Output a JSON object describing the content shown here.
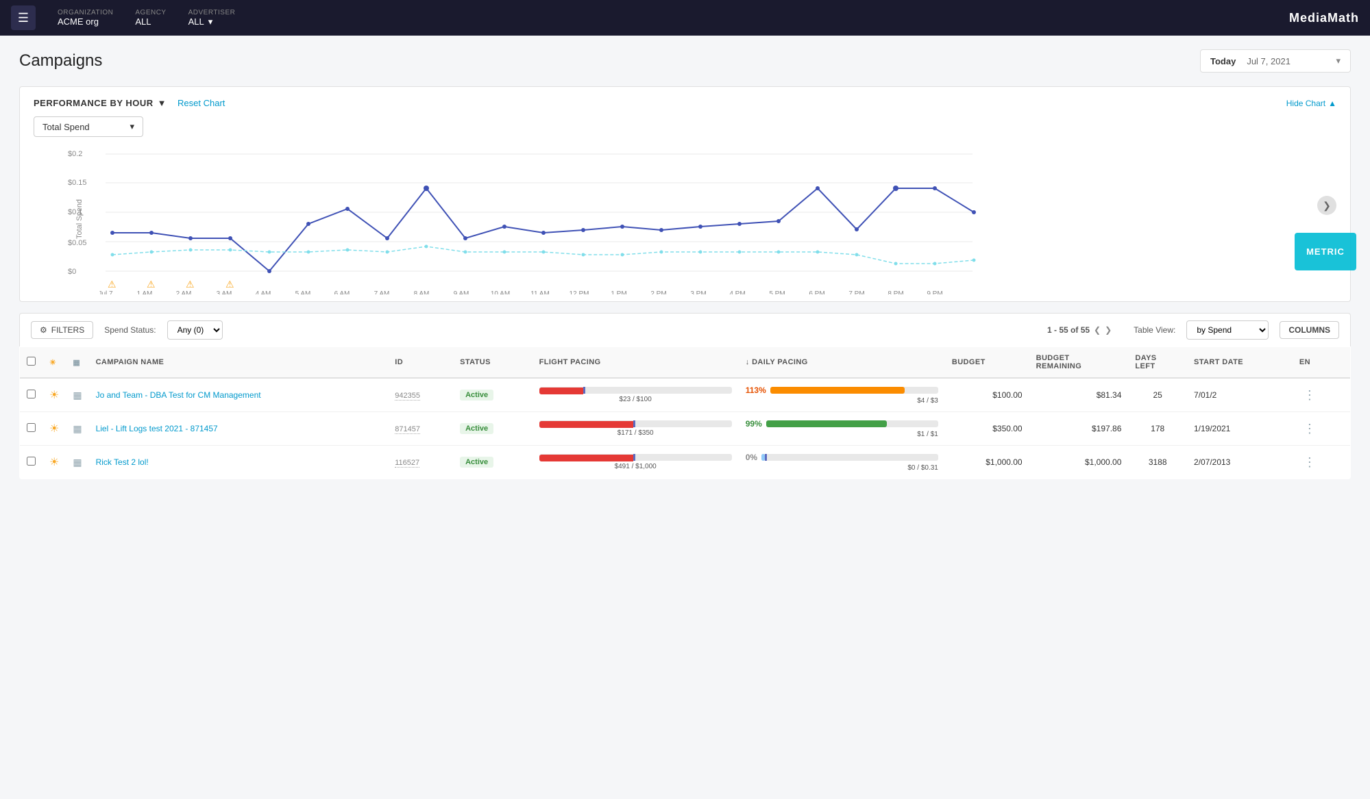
{
  "topnav": {
    "hamburger_label": "☰",
    "org_label": "ORGANIZATION",
    "org_value": "ACME org",
    "agency_label": "AGENCY",
    "agency_value": "ALL",
    "advertiser_label": "ADVERTISER",
    "advertiser_value": "ALL",
    "logo": "MediaMath"
  },
  "page": {
    "title": "Campaigns",
    "date_label": "Today",
    "date_value": "Jul 7, 2021",
    "hide_chart_label": "Hide Chart",
    "chart_section": {
      "perf_label": "PERFORMANCE BY  HOUR",
      "perf_arrow": "▼",
      "reset_chart_label": "Reset Chart",
      "metric_dropdown_label": "Total Spend",
      "y_axis_label": "Total Spend",
      "y_axis_values": [
        "$0.2",
        "$0.15",
        "$0.1",
        "$0.05",
        "$0"
      ],
      "x_axis_labels": [
        "Jul 7",
        "1 AM",
        "2 AM",
        "3 AM",
        "4 AM",
        "5 AM",
        "6 AM",
        "7 AM",
        "8 AM",
        "9 AM",
        "10 AM",
        "11 AM",
        "12 PM",
        "1 PM",
        "2 PM",
        "3 PM",
        "4 PM",
        "5 PM",
        "6 PM",
        "7 PM",
        "8 PM",
        "9 PM"
      ]
    }
  },
  "filters": {
    "filters_label": "FILTERS",
    "spend_status_label": "Spend Status:",
    "spend_status_value": "Any (0)",
    "pagination_text": "1 - 55 of 55",
    "table_view_label": "Table View:",
    "table_view_value": "by Spend",
    "columns_label": "COLUMNS"
  },
  "table": {
    "headers": [
      "",
      "",
      "",
      "CAMPAIGN NAME",
      "ID",
      "STATUS",
      "FLIGHT PACING",
      "DAILY PACING",
      "BUDGET",
      "BUDGET REMAINING",
      "DAYS LEFT",
      "START DATE",
      "EN"
    ],
    "rows": [
      {
        "id": "942355",
        "name": "Jo and Team - DBA Test for CM Management",
        "status": "Active",
        "flight_pct": 23,
        "flight_label": "$23 / $100",
        "daily_pct": 113,
        "daily_label": "$4 / $3",
        "budget": "$100.00",
        "budget_remaining": "$81.34",
        "days_left": "25",
        "start_date": "7/01/2",
        "flight_pacing_pct_label": "",
        "daily_pacing_pct_label": "113%"
      },
      {
        "id": "871457",
        "name": "Liel - Lift Logs test 2021 - 871457",
        "status": "Active",
        "flight_pct": 49,
        "flight_label": "$171 / $350",
        "daily_pct": 99,
        "daily_label": "$1 / $1",
        "budget": "$350.00",
        "budget_remaining": "$197.86",
        "days_left": "178",
        "start_date": "1/19/2021",
        "flight_pacing_pct_label": "",
        "daily_pacing_pct_label": "99%"
      },
      {
        "id": "116527",
        "name": "Rick Test 2 lol!",
        "status": "Active",
        "flight_pct": 49,
        "flight_label": "$491 / $1,000",
        "daily_pct": 0,
        "daily_label": "$0 / $0.31",
        "budget": "$1,000.00",
        "budget_remaining": "$1,000.00",
        "days_left": "3188",
        "start_date": "2/07/2013",
        "flight_pacing_pct_label": "",
        "daily_pacing_pct_label": "0%"
      }
    ]
  },
  "metric_overlay": {
    "label": "METRIC"
  }
}
